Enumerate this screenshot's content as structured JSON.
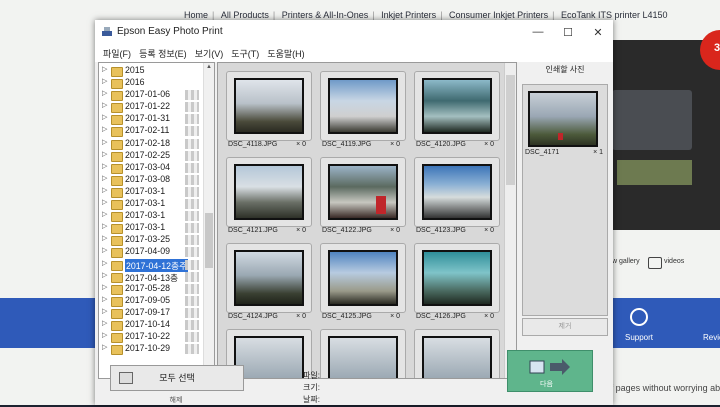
{
  "background_page": {
    "nav": [
      "Home",
      "All Products",
      "Printers & All-In-Ones",
      "Inkjet Printers",
      "Consumer Inkjet Printers",
      "EcoTank ITS printer L4150"
    ],
    "badge_text": "3",
    "gallery_label": "w gallery",
    "videos_label": "videos",
    "support_label": "Support",
    "review_label": "Revie",
    "bottom_text": "Letting you print thousands of pages without worrying abo"
  },
  "window": {
    "title": "Epson Easy Photo Print",
    "menu": [
      "파일(F)",
      "등록 정보(E)",
      "보기(V)",
      "도구(T)",
      "도움말(H)"
    ]
  },
  "tree": {
    "items": [
      "2015",
      "2016",
      "2017-01-06",
      "2017-01-22",
      "2017-01-31",
      "2017-02-11",
      "2017-02-18",
      "2017-02-25",
      "2017-03-04",
      "2017-03-08",
      "2017-03-1",
      "2017-03-1",
      "2017-03-1",
      "2017-03-1",
      "2017-03-25",
      "2017-04-09",
      "2017-04-12충주",
      "2017-04-13충",
      "2017-05-28",
      "2017-09-05",
      "2017-09-17",
      "2017-10-14",
      "2017-10-22",
      "2017-10-29"
    ],
    "selected_index": 16
  },
  "grid": {
    "items": [
      {
        "name": "DSC_4118.JPG",
        "count": "× 0"
      },
      {
        "name": "DSC_4119.JPG",
        "count": "× 0"
      },
      {
        "name": "DSC_4120.JPG",
        "count": "× 0"
      },
      {
        "name": "DSC_4121.JPG",
        "count": "× 0"
      },
      {
        "name": "DSC_4122.JPG",
        "count": "× 0"
      },
      {
        "name": "DSC_4123.JPG",
        "count": "× 0"
      },
      {
        "name": "DSC_4124.JPG",
        "count": "× 0"
      },
      {
        "name": "DSC_4125.JPG",
        "count": "× 0"
      },
      {
        "name": "DSC_4126.JPG",
        "count": "× 0"
      }
    ]
  },
  "print_panel": {
    "title": "인쇄할 사진",
    "item": {
      "name": "DSC_4171",
      "count": "× 1"
    },
    "remove_label": "제거",
    "next_label": "다음"
  },
  "bottom": {
    "select_all_label": "모두 선택",
    "release_label": "해제",
    "file_label": "파일:",
    "size_label": "크기:",
    "date_label": "날짜:"
  }
}
